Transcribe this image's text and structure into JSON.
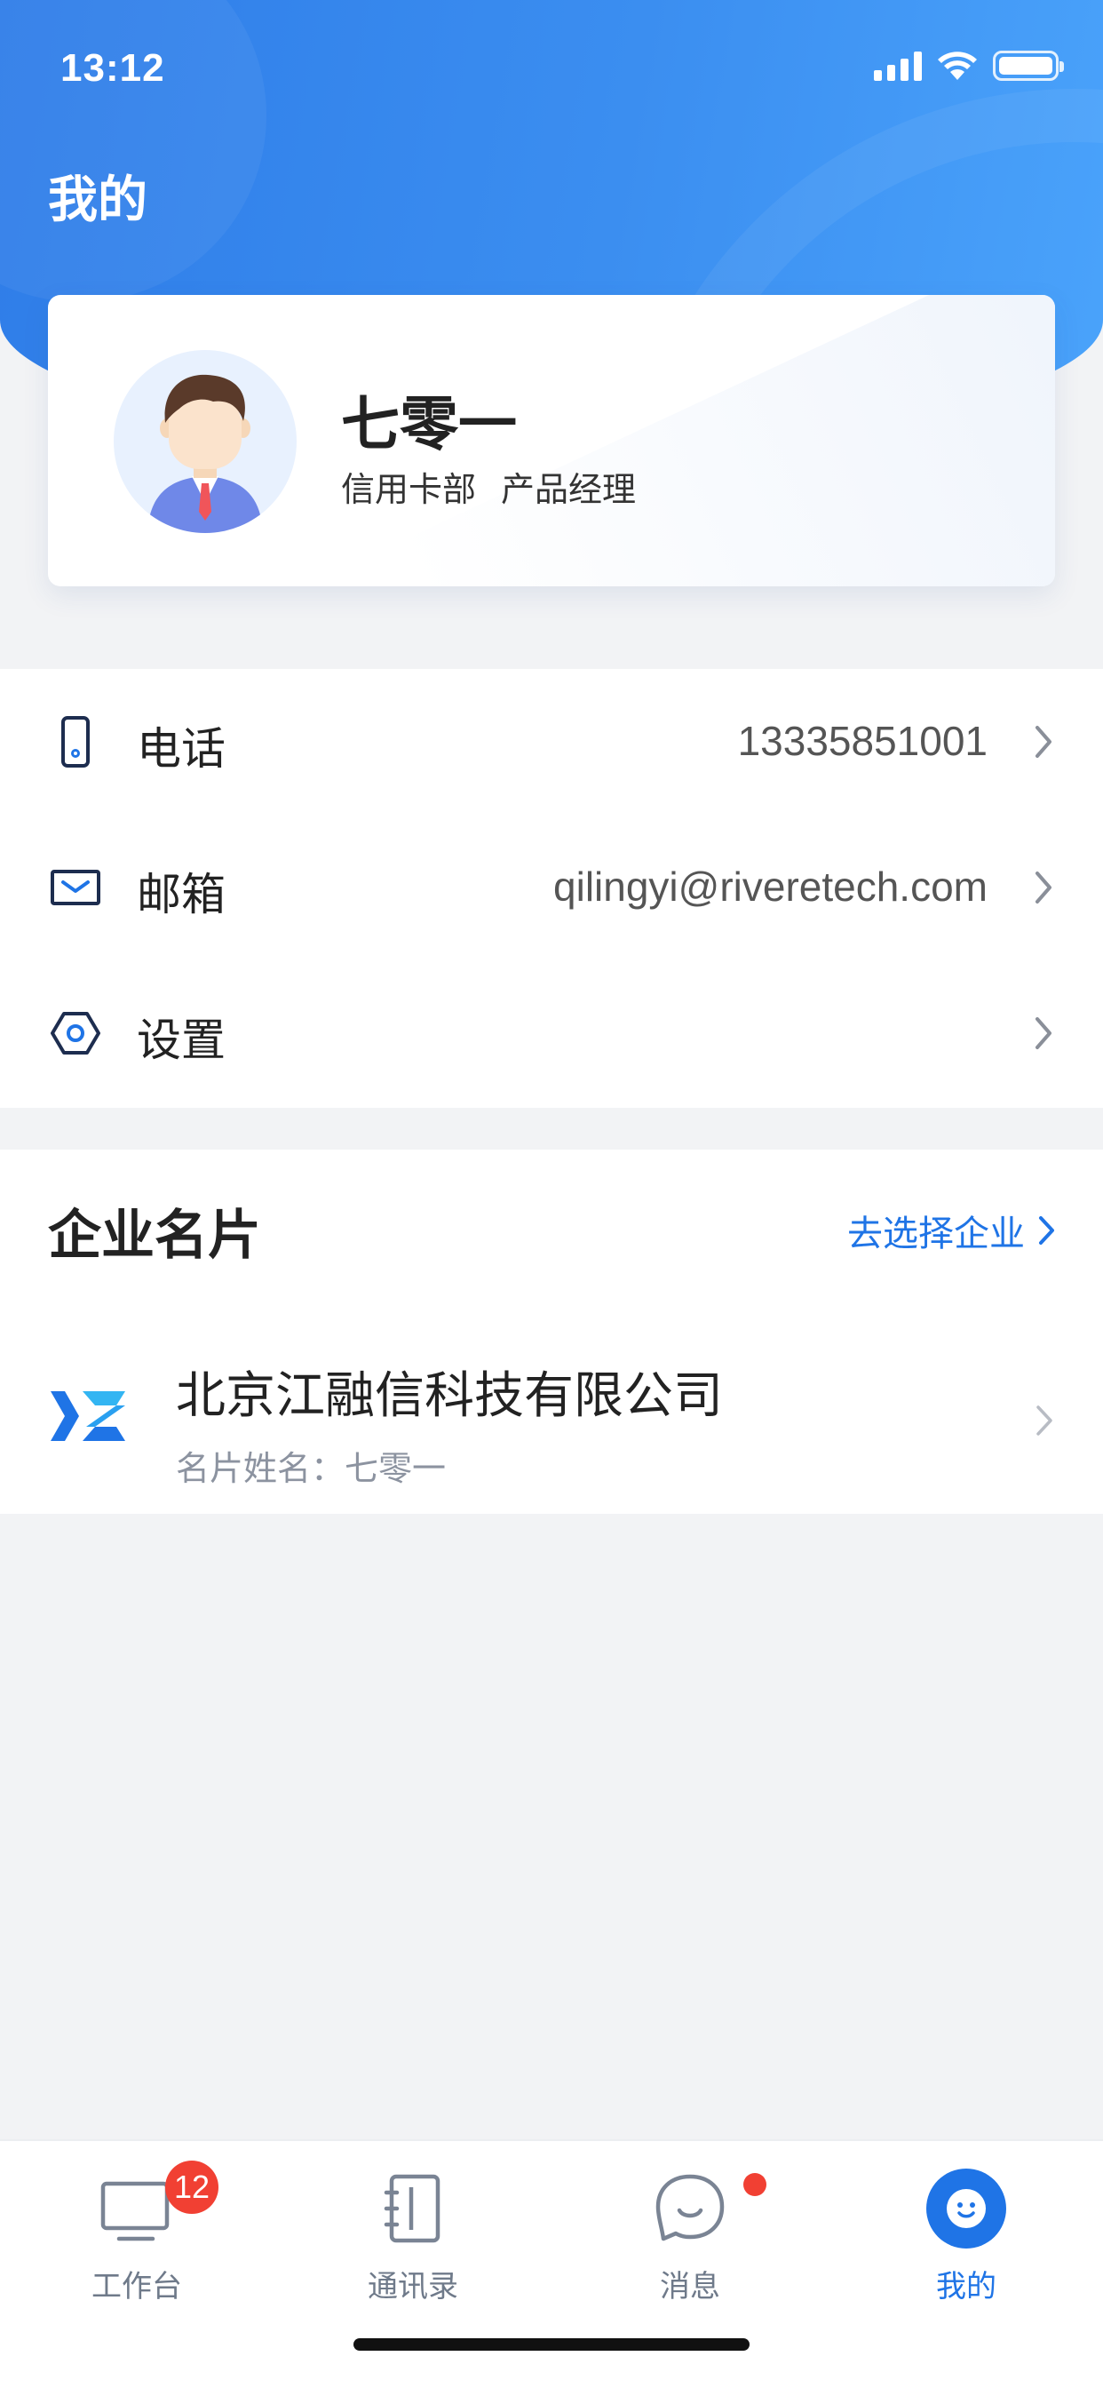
{
  "status_bar": {
    "time": "13:12"
  },
  "header": {
    "title": "我的"
  },
  "profile": {
    "name": "七零一",
    "department": "信用卡部",
    "position": "产品经理"
  },
  "info_rows": [
    {
      "icon": "phone-icon",
      "label": "电话",
      "value": "13335851001"
    },
    {
      "icon": "mail-icon",
      "label": "邮箱",
      "value": "qilingyi@riveretech.com"
    },
    {
      "icon": "settings-icon",
      "label": "设置",
      "value": ""
    }
  ],
  "company_section": {
    "title": "企业名片",
    "select_link": "去选择企业",
    "company": {
      "name": "北京江融信科技有限公司",
      "card_name": "名片姓名：七零一"
    }
  },
  "tab_bar": {
    "tabs": [
      {
        "label": "工作台",
        "icon": "workbench-icon",
        "badge": "12",
        "active": false
      },
      {
        "label": "通讯录",
        "icon": "contacts-icon",
        "active": false
      },
      {
        "label": "消息",
        "icon": "message-icon",
        "dot": true,
        "active": false
      },
      {
        "label": "我的",
        "icon": "me-icon",
        "active": true
      }
    ]
  },
  "colors": {
    "accent": "#1f74e6",
    "header_gradient_start": "#2f7de8",
    "header_gradient_end": "#4aa3fb",
    "badge": "#f14033",
    "background": "#f2f3f5"
  }
}
